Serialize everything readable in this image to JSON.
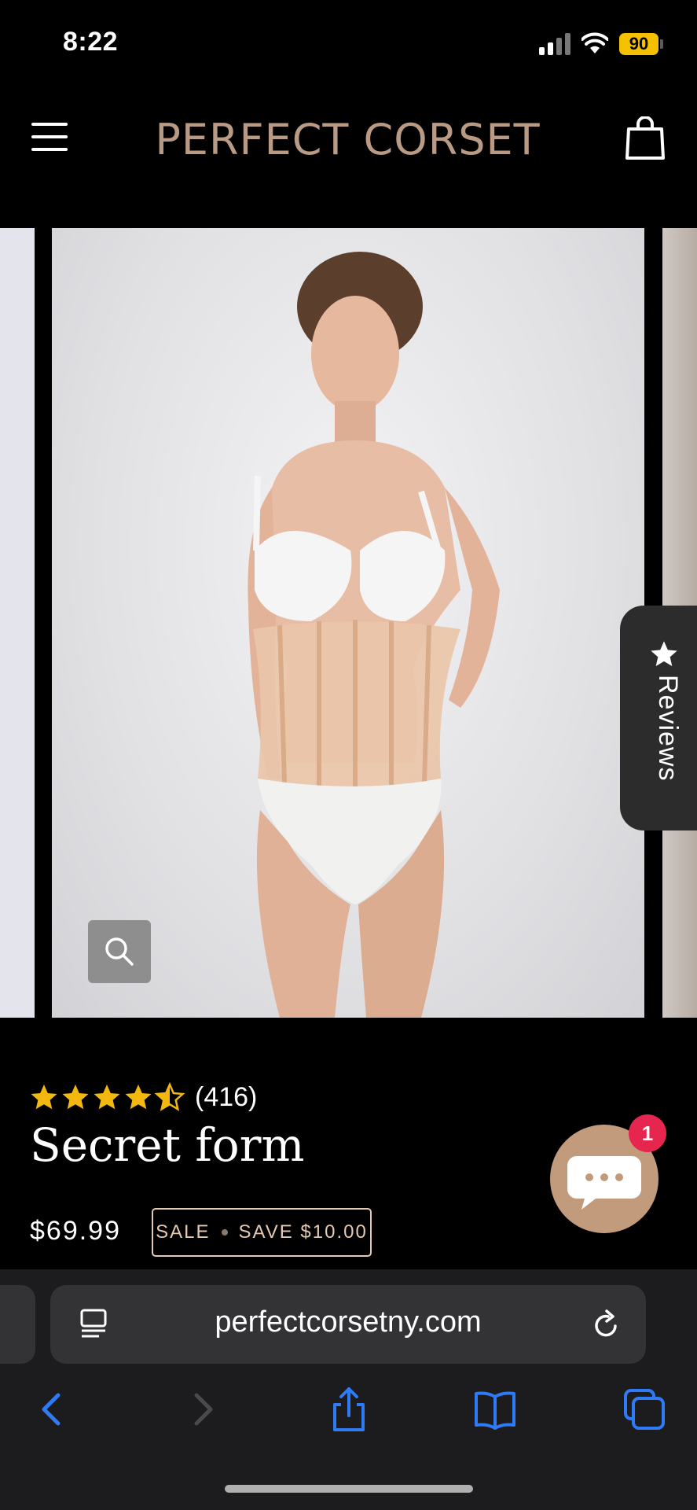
{
  "status_bar": {
    "time": "8:22",
    "battery": "90"
  },
  "header": {
    "brand": "PERFECT CORSET"
  },
  "reviews_tab": {
    "label": "Reviews"
  },
  "product": {
    "rating": 4.5,
    "review_count": "(416)",
    "title": "Secret form",
    "price": "$69.99",
    "sale_label": "SALE",
    "save_label": "SAVE $10.00"
  },
  "chat": {
    "badge_count": "1"
  },
  "browser": {
    "url": "perfectcorsetny.com"
  },
  "colors": {
    "brand": "#b89a85",
    "star": "#f2b80f",
    "accent_link": "#2f7bf5",
    "badge": "#e6264e",
    "chat": "#c29b7c"
  }
}
